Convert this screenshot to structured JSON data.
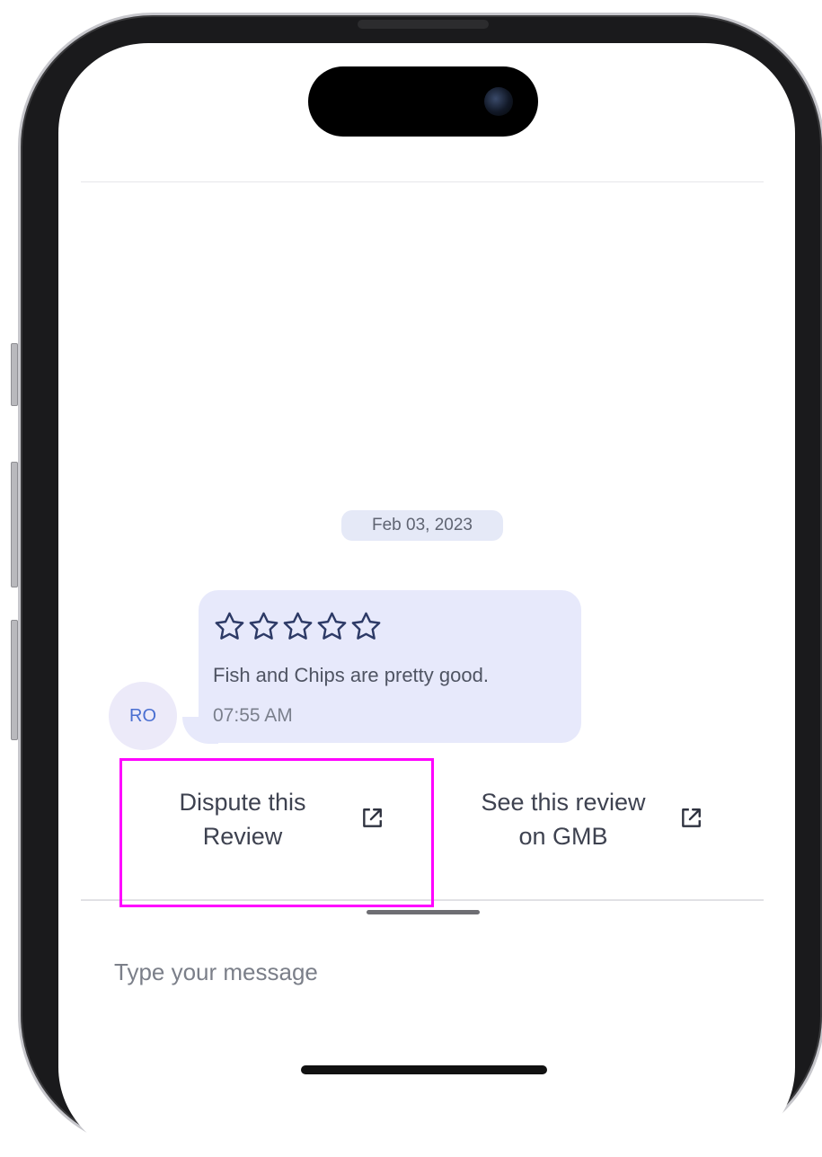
{
  "colors": {
    "accent_highlight": "#ff00ff",
    "bubble_bg": "#e7e9fb",
    "date_chip_bg": "#e5e9f7",
    "avatar_text": "#4a6fd1",
    "star_outline": "#2d3a66"
  },
  "chat": {
    "date_label": "Feb 03, 2023",
    "avatar_initials": "RO",
    "review": {
      "rating": 0,
      "max_rating": 5,
      "star_icon": "star-outline-icon",
      "text": "Fish and Chips are pretty good.",
      "time": "07:55 AM"
    }
  },
  "actions": {
    "dispute": {
      "line1": "Dispute this",
      "line2": "Review",
      "icon": "external-link-icon"
    },
    "see_review": {
      "line1": "See this review",
      "line2": "on GMB",
      "icon": "external-link-icon"
    }
  },
  "composer": {
    "placeholder": "Type your message"
  }
}
